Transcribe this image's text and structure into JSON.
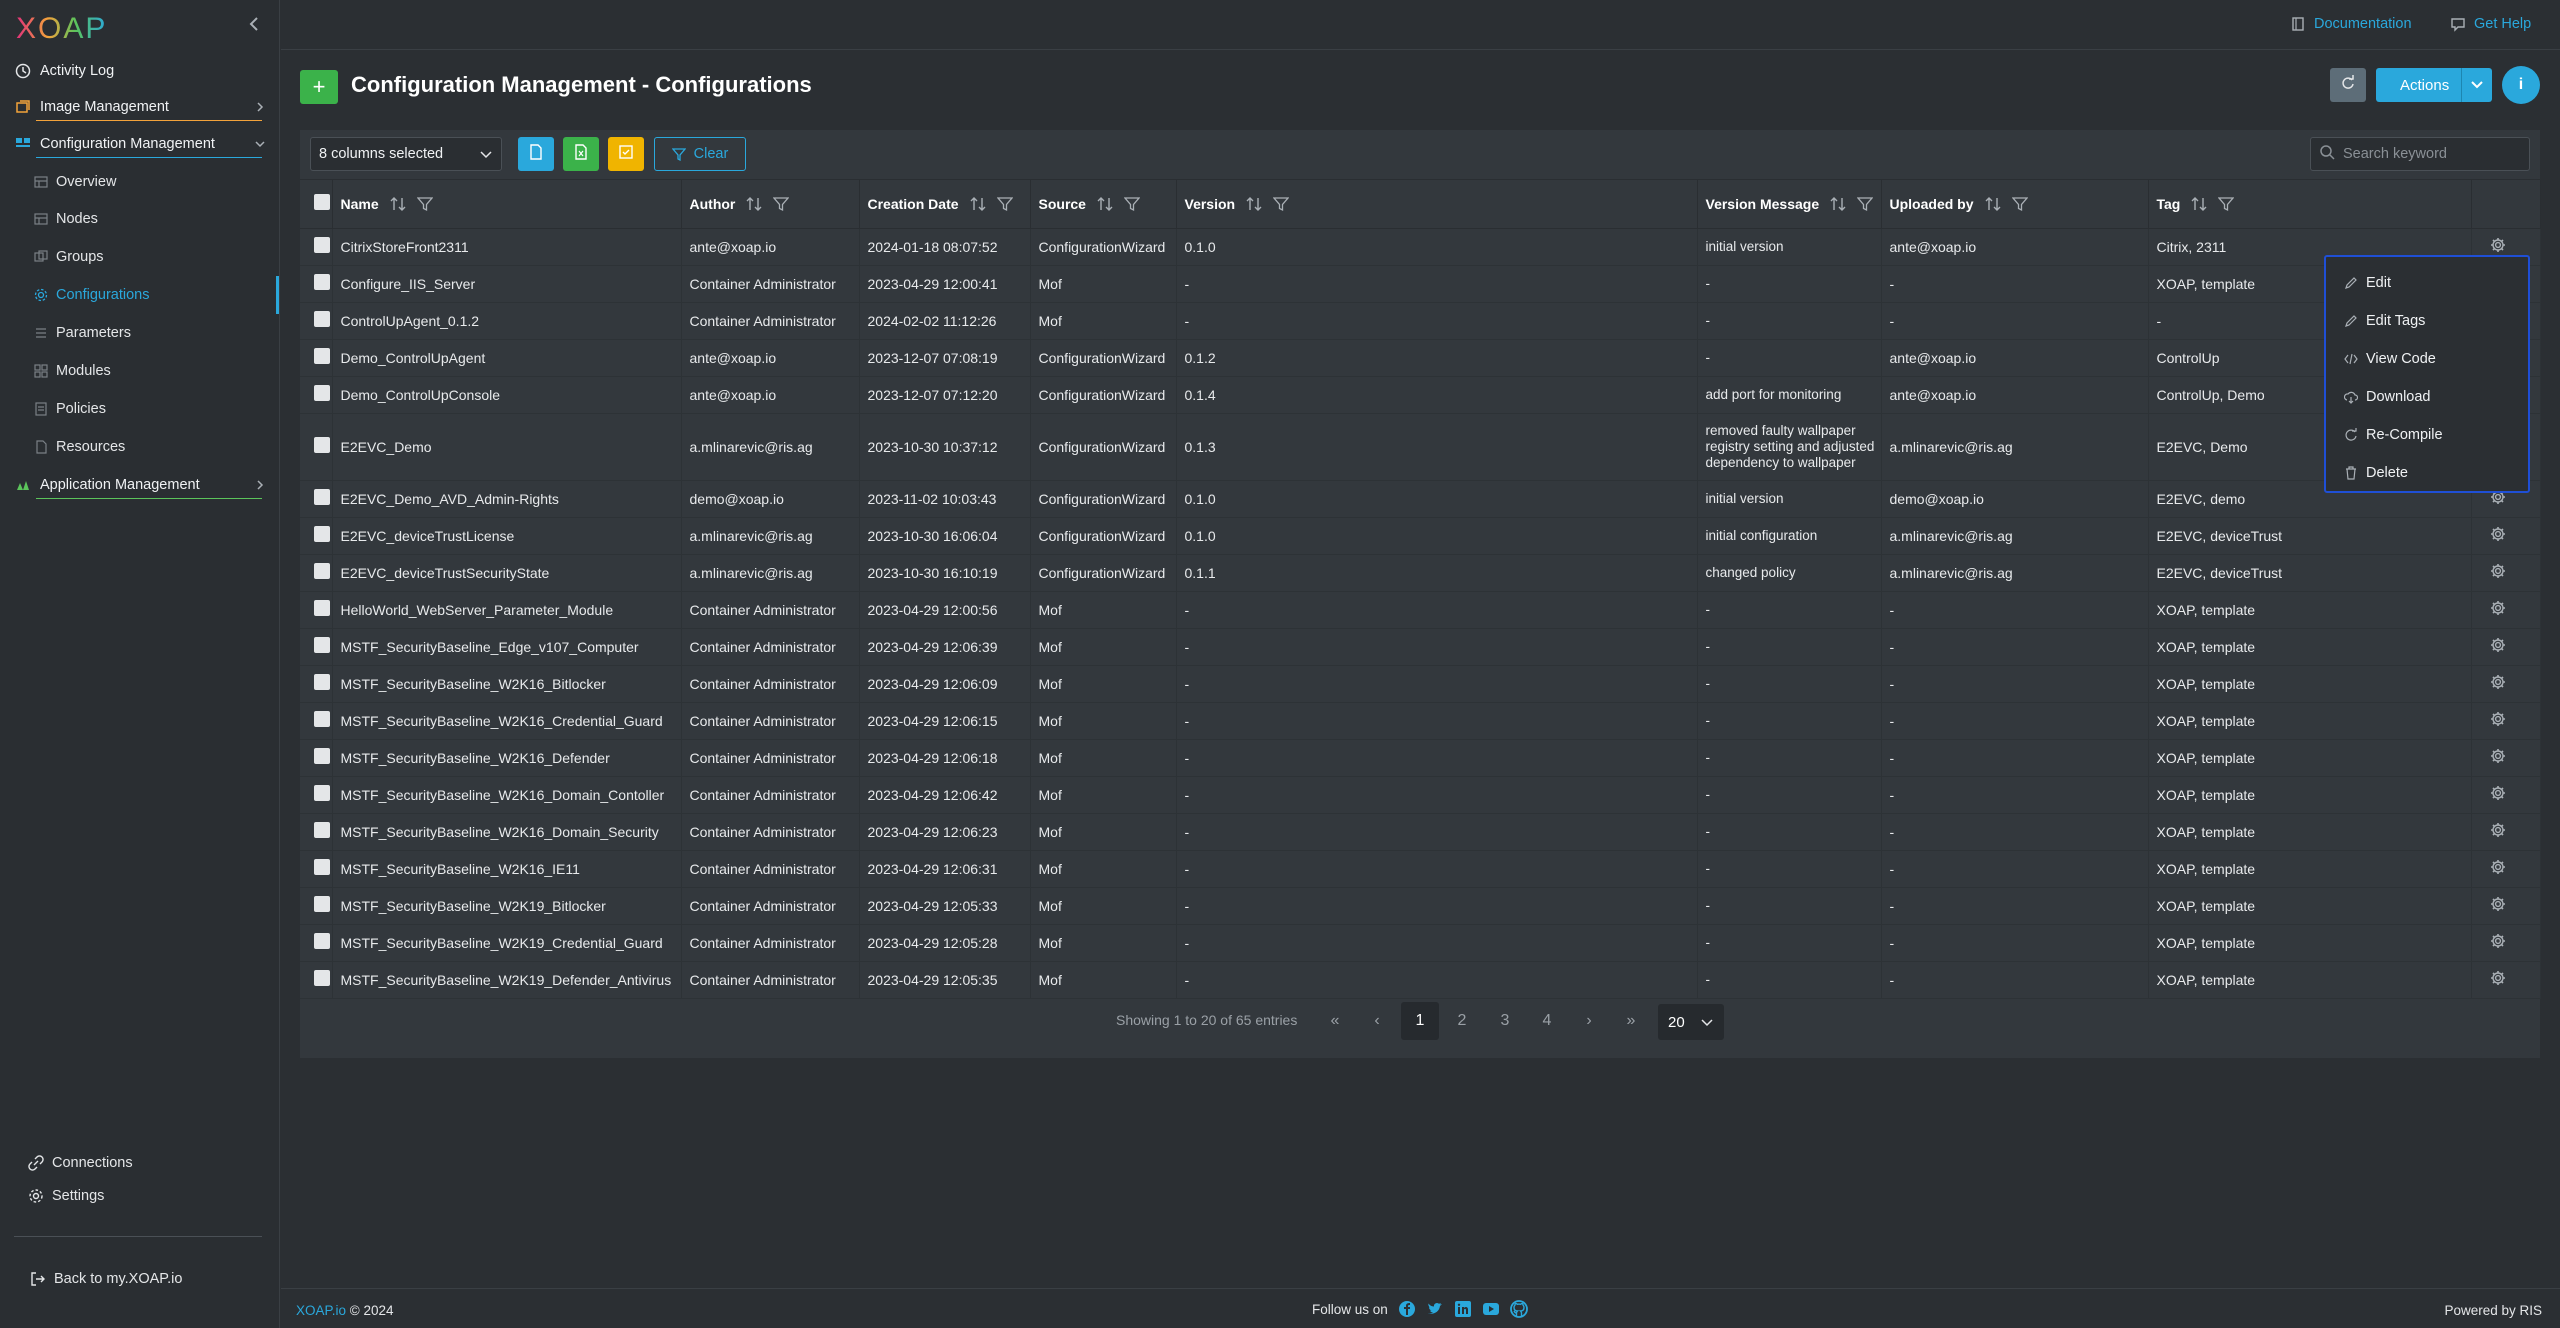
{
  "logo": "XOAP",
  "sidebar": {
    "items": [
      {
        "label": "Activity Log"
      },
      {
        "label": "Image Management"
      },
      {
        "label": "Configuration Management"
      },
      {
        "label": "Application Management"
      }
    ],
    "config_sub": [
      "Overview",
      "Nodes",
      "Groups",
      "Configurations",
      "Parameters",
      "Modules",
      "Policies",
      "Resources"
    ],
    "active_sub": "Configurations",
    "bottom": {
      "connections": "Connections",
      "settings": "Settings",
      "back": "Back to my.XOAP.io"
    }
  },
  "topbar": {
    "documentation": "Documentation",
    "get_help": "Get Help"
  },
  "header": {
    "title": "Configuration Management - Configurations",
    "actions": "Actions",
    "info": "i"
  },
  "toolbar": {
    "columns_selected": "8 columns selected",
    "clear": "Clear",
    "search_placeholder": "Search keyword"
  },
  "table": {
    "columns": [
      "Name",
      "Author",
      "Creation Date",
      "Source",
      "Version",
      "Version Message",
      "Uploaded by",
      "Tag"
    ],
    "rows": [
      [
        "CitrixStoreFront2311",
        "ante@xoap.io",
        "2024-01-18 08:07:52",
        "ConfigurationWizard",
        "0.1.0",
        "initial version",
        "ante@xoap.io",
        "Citrix, 2311"
      ],
      [
        "Configure_IIS_Server",
        "Container Administrator",
        "2023-04-29 12:00:41",
        "Mof",
        "-",
        "-",
        "-",
        "XOAP, template"
      ],
      [
        "ControlUpAgent_0.1.2",
        "Container Administrator",
        "2024-02-02 11:12:26",
        "Mof",
        "-",
        "-",
        "-",
        "-"
      ],
      [
        "Demo_ControlUpAgent",
        "ante@xoap.io",
        "2023-12-07 07:08:19",
        "ConfigurationWizard",
        "0.1.2",
        "-",
        "ante@xoap.io",
        "ControlUp"
      ],
      [
        "Demo_ControlUpConsole",
        "ante@xoap.io",
        "2023-12-07 07:12:20",
        "ConfigurationWizard",
        "0.1.4",
        "add port for monitoring",
        "ante@xoap.io",
        "ControlUp, Demo"
      ],
      [
        "E2EVC_Demo",
        "a.mlinarevic@ris.ag",
        "2023-10-30 10:37:12",
        "ConfigurationWizard",
        "0.1.3",
        "removed faulty wallpaper registry setting and adjusted dependency to wallpaper",
        "a.mlinarevic@ris.ag",
        "E2EVC, Demo"
      ],
      [
        "E2EVC_Demo_AVD_Admin-Rights",
        "demo@xoap.io",
        "2023-11-02 10:03:43",
        "ConfigurationWizard",
        "0.1.0",
        "initial version",
        "demo@xoap.io",
        "E2EVC, demo"
      ],
      [
        "E2EVC_deviceTrustLicense",
        "a.mlinarevic@ris.ag",
        "2023-10-30 16:06:04",
        "ConfigurationWizard",
        "0.1.0",
        "initial configuration",
        "a.mlinarevic@ris.ag",
        "E2EVC, deviceTrust"
      ],
      [
        "E2EVC_deviceTrustSecurityState",
        "a.mlinarevic@ris.ag",
        "2023-10-30 16:10:19",
        "ConfigurationWizard",
        "0.1.1",
        "changed policy",
        "a.mlinarevic@ris.ag",
        "E2EVC, deviceTrust"
      ],
      [
        "HelloWorld_WebServer_Parameter_Module",
        "Container Administrator",
        "2023-04-29 12:00:56",
        "Mof",
        "-",
        "-",
        "-",
        "XOAP, template"
      ],
      [
        "MSTF_SecurityBaseline_Edge_v107_Computer",
        "Container Administrator",
        "2023-04-29 12:06:39",
        "Mof",
        "-",
        "-",
        "-",
        "XOAP, template"
      ],
      [
        "MSTF_SecurityBaseline_W2K16_Bitlocker",
        "Container Administrator",
        "2023-04-29 12:06:09",
        "Mof",
        "-",
        "-",
        "-",
        "XOAP, template"
      ],
      [
        "MSTF_SecurityBaseline_W2K16_Credential_Guard",
        "Container Administrator",
        "2023-04-29 12:06:15",
        "Mof",
        "-",
        "-",
        "-",
        "XOAP, template"
      ],
      [
        "MSTF_SecurityBaseline_W2K16_Defender",
        "Container Administrator",
        "2023-04-29 12:06:18",
        "Mof",
        "-",
        "-",
        "-",
        "XOAP, template"
      ],
      [
        "MSTF_SecurityBaseline_W2K16_Domain_Contoller",
        "Container Administrator",
        "2023-04-29 12:06:42",
        "Mof",
        "-",
        "-",
        "-",
        "XOAP, template"
      ],
      [
        "MSTF_SecurityBaseline_W2K16_Domain_Security",
        "Container Administrator",
        "2023-04-29 12:06:23",
        "Mof",
        "-",
        "-",
        "-",
        "XOAP, template"
      ],
      [
        "MSTF_SecurityBaseline_W2K16_IE11",
        "Container Administrator",
        "2023-04-29 12:06:31",
        "Mof",
        "-",
        "-",
        "-",
        "XOAP, template"
      ],
      [
        "MSTF_SecurityBaseline_W2K19_Bitlocker",
        "Container Administrator",
        "2023-04-29 12:05:33",
        "Mof",
        "-",
        "-",
        "-",
        "XOAP, template"
      ],
      [
        "MSTF_SecurityBaseline_W2K19_Credential_Guard",
        "Container Administrator",
        "2023-04-29 12:05:28",
        "Mof",
        "-",
        "-",
        "-",
        "XOAP, template"
      ],
      [
        "MSTF_SecurityBaseline_W2K19_Defender_Antivirus",
        "Container Administrator",
        "2023-04-29 12:05:35",
        "Mof",
        "-",
        "-",
        "-",
        "XOAP, template"
      ]
    ]
  },
  "pagination": {
    "info": "Showing 1 to 20 of 65 entries",
    "pages": [
      "1",
      "2",
      "3",
      "4"
    ],
    "current": "1",
    "per_page": "20"
  },
  "context_menu": {
    "items": [
      "Edit",
      "Edit Tags",
      "View Code",
      "Download",
      "Re-Compile",
      "Delete"
    ]
  },
  "footer": {
    "brand": "XOAP.io",
    "copyright": " © 2024",
    "follow": "Follow us on",
    "powered": "Powered by RIS"
  },
  "colors": {
    "accent": "#2aa8dc",
    "add": "#3bb24a",
    "export_csv": "#2aa8dc",
    "export_excel": "#3bb24a",
    "export_pdf": "#f0b400",
    "menu_border": "#1f4fd6"
  }
}
